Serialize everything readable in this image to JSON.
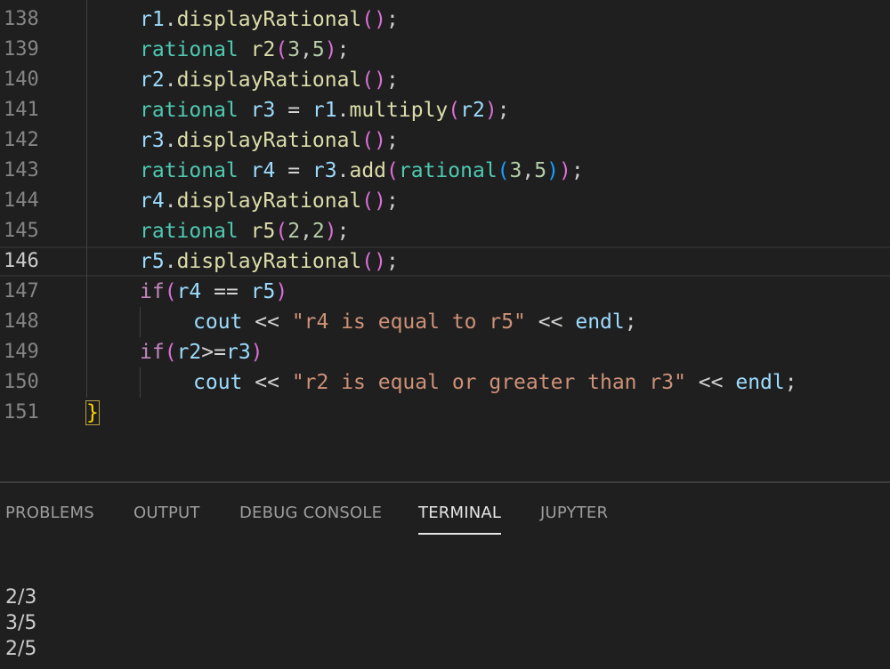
{
  "editor": {
    "lines": [
      {
        "n": "138",
        "indent": 1,
        "tokens": [
          [
            "r1",
            "t-ident"
          ],
          [
            ".",
            ""
          ],
          [
            "displayRational",
            "t-fn"
          ],
          [
            "(",
            "t-p1"
          ],
          [
            ")",
            "t-p1"
          ],
          [
            ";",
            ""
          ]
        ]
      },
      {
        "n": "139",
        "indent": 1,
        "tokens": [
          [
            "rational",
            "t-type"
          ],
          [
            " ",
            ""
          ],
          [
            "r2",
            "t-fn"
          ],
          [
            "(",
            "t-p1"
          ],
          [
            "3",
            "t-num"
          ],
          [
            ",",
            ""
          ],
          [
            "5",
            "t-num"
          ],
          [
            ")",
            "t-p1"
          ],
          [
            ";",
            ""
          ]
        ]
      },
      {
        "n": "140",
        "indent": 1,
        "tokens": [
          [
            "r2",
            "t-ident"
          ],
          [
            ".",
            ""
          ],
          [
            "displayRational",
            "t-fn"
          ],
          [
            "(",
            "t-p1"
          ],
          [
            ")",
            "t-p1"
          ],
          [
            ";",
            ""
          ]
        ]
      },
      {
        "n": "141",
        "indent": 1,
        "tokens": [
          [
            "rational",
            "t-type"
          ],
          [
            " ",
            ""
          ],
          [
            "r3",
            "t-ident"
          ],
          [
            " ",
            ""
          ],
          [
            "=",
            "t-op"
          ],
          [
            " ",
            ""
          ],
          [
            "r1",
            "t-ident"
          ],
          [
            ".",
            ""
          ],
          [
            "multiply",
            "t-fn"
          ],
          [
            "(",
            "t-p1"
          ],
          [
            "r2",
            "t-ident"
          ],
          [
            ")",
            "t-p1"
          ],
          [
            ";",
            ""
          ]
        ]
      },
      {
        "n": "142",
        "indent": 1,
        "tokens": [
          [
            "r3",
            "t-ident"
          ],
          [
            ".",
            ""
          ],
          [
            "displayRational",
            "t-fn"
          ],
          [
            "(",
            "t-p1"
          ],
          [
            ")",
            "t-p1"
          ],
          [
            ";",
            ""
          ]
        ]
      },
      {
        "n": "143",
        "indent": 1,
        "tokens": [
          [
            "rational",
            "t-type"
          ],
          [
            " ",
            ""
          ],
          [
            "r4",
            "t-ident"
          ],
          [
            " ",
            ""
          ],
          [
            "=",
            "t-op"
          ],
          [
            " ",
            ""
          ],
          [
            "r3",
            "t-ident"
          ],
          [
            ".",
            ""
          ],
          [
            "add",
            "t-fn"
          ],
          [
            "(",
            "t-p1"
          ],
          [
            "rational",
            "t-type"
          ],
          [
            "(",
            "t-p2"
          ],
          [
            "3",
            "t-num"
          ],
          [
            ",",
            ""
          ],
          [
            "5",
            "t-num"
          ],
          [
            ")",
            "t-p2"
          ],
          [
            ")",
            "t-p1"
          ],
          [
            ";",
            ""
          ]
        ]
      },
      {
        "n": "144",
        "indent": 1,
        "tokens": [
          [
            "r4",
            "t-ident"
          ],
          [
            ".",
            ""
          ],
          [
            "displayRational",
            "t-fn"
          ],
          [
            "(",
            "t-p1"
          ],
          [
            ")",
            "t-p1"
          ],
          [
            ";",
            ""
          ]
        ]
      },
      {
        "n": "145",
        "indent": 1,
        "tokens": [
          [
            "rational",
            "t-type"
          ],
          [
            " ",
            ""
          ],
          [
            "r5",
            "t-fn"
          ],
          [
            "(",
            "t-p1"
          ],
          [
            "2",
            "t-num"
          ],
          [
            ",",
            ""
          ],
          [
            "2",
            "t-num"
          ],
          [
            ")",
            "t-p1"
          ],
          [
            ";",
            ""
          ]
        ]
      },
      {
        "n": "146",
        "indent": 1,
        "current": true,
        "tokens": [
          [
            "r5",
            "t-ident"
          ],
          [
            ".",
            ""
          ],
          [
            "displayRational",
            "t-fn"
          ],
          [
            "(",
            "t-p1"
          ],
          [
            ")",
            "t-p1"
          ],
          [
            ";",
            ""
          ]
        ]
      },
      {
        "n": "147",
        "indent": 1,
        "tokens": [
          [
            "if",
            "t-kw"
          ],
          [
            "(",
            "t-p1"
          ],
          [
            "r4",
            "t-ident"
          ],
          [
            " ",
            ""
          ],
          [
            "==",
            "t-op"
          ],
          [
            " ",
            ""
          ],
          [
            "r5",
            "t-ident"
          ],
          [
            ")",
            "t-p1"
          ]
        ]
      },
      {
        "n": "148",
        "indent": 2,
        "tokens": [
          [
            "cout",
            "t-ident"
          ],
          [
            " ",
            ""
          ],
          [
            "<<",
            "t-op"
          ],
          [
            " ",
            ""
          ],
          [
            "\"r4 is equal to r5\"",
            "t-str"
          ],
          [
            " ",
            ""
          ],
          [
            "<<",
            "t-op"
          ],
          [
            " ",
            ""
          ],
          [
            "endl",
            "t-ident"
          ],
          [
            ";",
            ""
          ]
        ]
      },
      {
        "n": "149",
        "indent": 1,
        "tokens": [
          [
            "if",
            "t-kw"
          ],
          [
            "(",
            "t-p1"
          ],
          [
            "r2",
            "t-ident"
          ],
          [
            ">=",
            "t-op"
          ],
          [
            "r3",
            "t-ident"
          ],
          [
            ")",
            "t-p1"
          ]
        ]
      },
      {
        "n": "150",
        "indent": 2,
        "tokens": [
          [
            "cout",
            "t-ident"
          ],
          [
            " ",
            ""
          ],
          [
            "<<",
            "t-op"
          ],
          [
            " ",
            ""
          ],
          [
            "\"r2 is equal or greater than r3\"",
            "t-str"
          ],
          [
            " ",
            ""
          ],
          [
            "<<",
            "t-op"
          ],
          [
            " ",
            ""
          ],
          [
            "endl",
            "t-ident"
          ],
          [
            ";",
            ""
          ]
        ]
      },
      {
        "n": "151",
        "indent": 0,
        "tokens": [
          [
            "}",
            "t-brace"
          ]
        ]
      }
    ]
  },
  "panel": {
    "tabs": [
      {
        "label": "PROBLEMS",
        "name": "tab-problems"
      },
      {
        "label": "OUTPUT",
        "name": "tab-output"
      },
      {
        "label": "DEBUG CONSOLE",
        "name": "tab-debug-console"
      },
      {
        "label": "TERMINAL",
        "name": "tab-terminal",
        "active": true
      },
      {
        "label": "JUPYTER",
        "name": "tab-jupyter"
      }
    ],
    "terminal_lines": [
      "2/3",
      "3/5",
      "2/5"
    ]
  }
}
